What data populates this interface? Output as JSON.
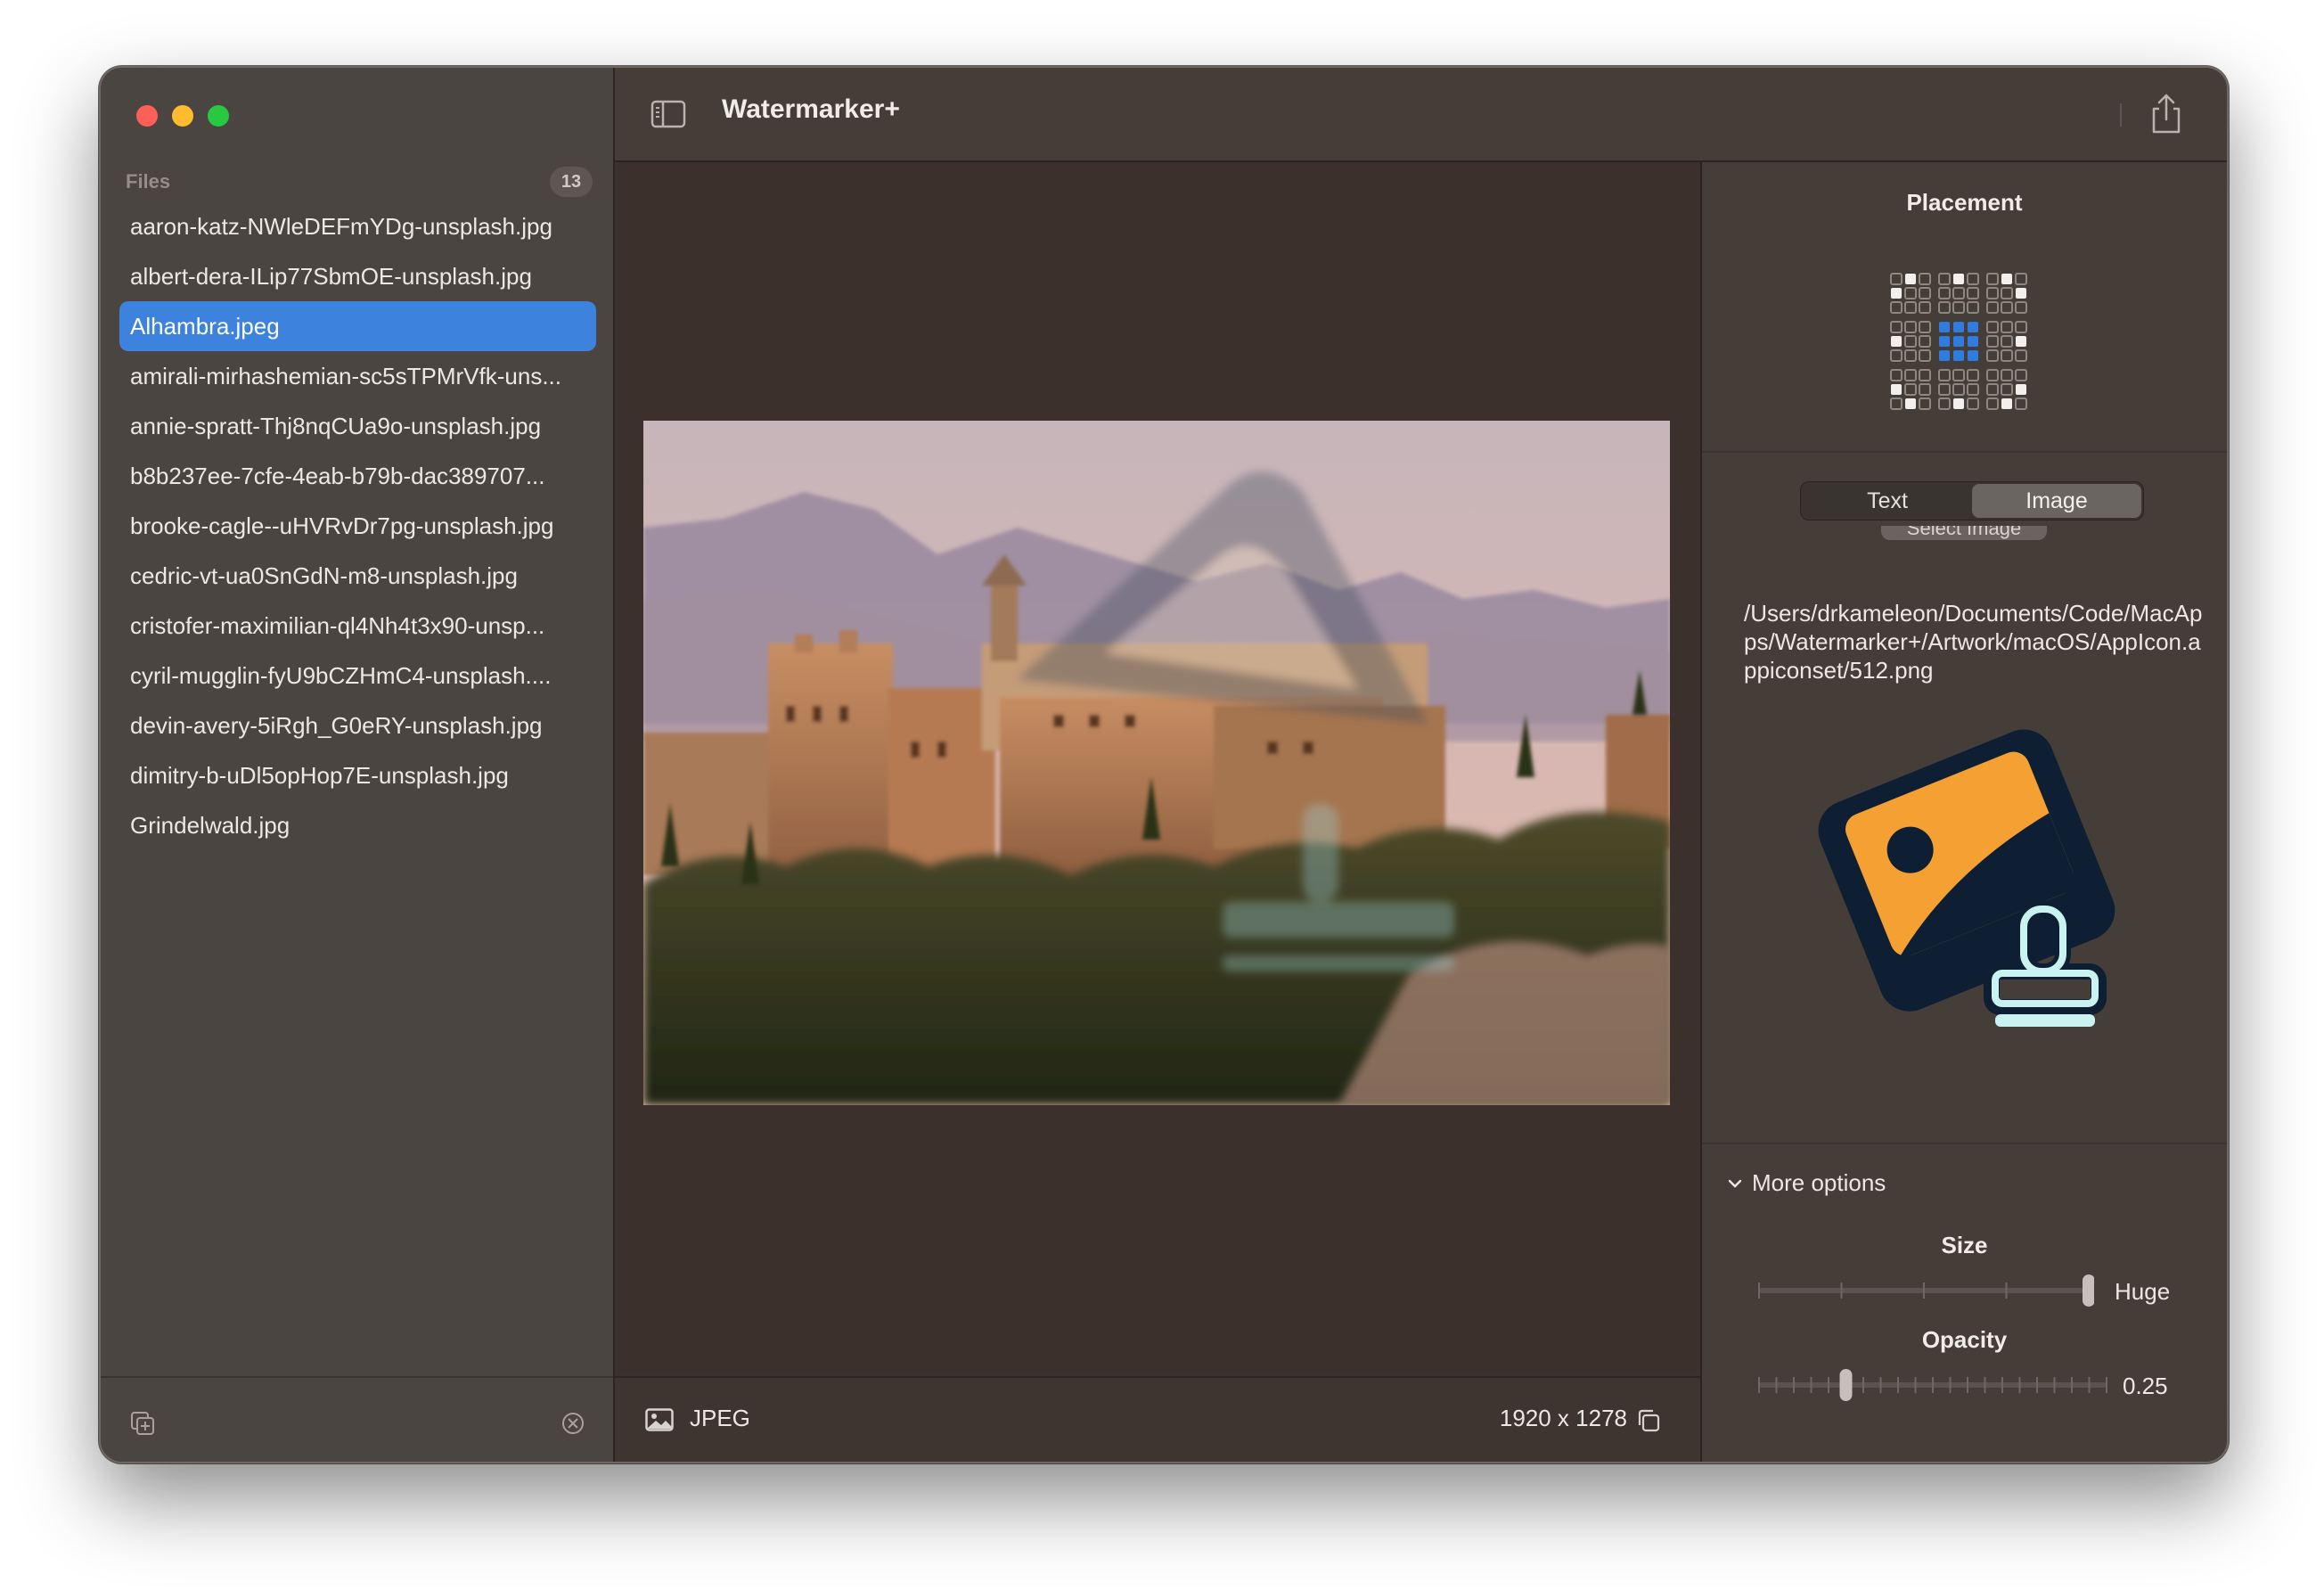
{
  "app": {
    "title": "Watermarker+"
  },
  "sidebar": {
    "section_title": "Files",
    "file_count": "13",
    "files": [
      "aaron-katz-NWleDEFmYDg-unsplash.jpg",
      "albert-dera-ILip77SbmOE-unsplash.jpg",
      "Alhambra.jpeg",
      "amirali-mirhashemian-sc5sTPMrVfk-uns...",
      "annie-spratt-Thj8nqCUa9o-unsplash.jpg",
      "b8b237ee-7cfe-4eab-b79b-dac389707...",
      "brooke-cagle--uHVRvDr7pg-unsplash.jpg",
      "cedric-vt-ua0SnGdN-m8-unsplash.jpg",
      "cristofer-maximilian-ql4Nh4t3x90-unsp...",
      "cyril-mugglin-fyU9bCZHmC4-unsplash....",
      "devin-avery-5iRgh_G0eRY-unsplash.jpg",
      "dimitry-b-uDl5opHop7E-unsplash.jpg",
      "Grindelwald.jpg"
    ],
    "selected_index": 2
  },
  "canvas": {
    "format": "JPEG",
    "dimensions": "1920 x 1278"
  },
  "inspector": {
    "placement_title": "Placement",
    "segments": [
      "Text",
      "Image"
    ],
    "active_segment": "Image",
    "select_button_label": "Select Image",
    "image_path": "/Users/drkameleon/Documents/Code/MacApps/Watermarker+/Artwork/macOS/AppIcon.appiconset/512.png",
    "more_options_label": "More options",
    "size": {
      "label": "Size",
      "value": "Huge",
      "fraction": 1.0
    },
    "opacity": {
      "label": "Opacity",
      "value": "0.25",
      "fraction": 0.25
    }
  },
  "colors": {
    "accent": "#3d82dc",
    "sidebar_bg": "#4b4541",
    "canvas_bg": "#3b302b",
    "icon_orange": "#f5a033",
    "icon_navy": "#0e1f33",
    "icon_mint": "#c8f3f0"
  },
  "icons": {
    "toolbar_left": "sidebar-toggle-icon",
    "toolbar_right": "share-icon",
    "sidebar_bottom_left": "add-files-icon",
    "sidebar_bottom_right": "clear-icon",
    "footer_left": "photo-icon",
    "footer_right": "copy-icon"
  }
}
